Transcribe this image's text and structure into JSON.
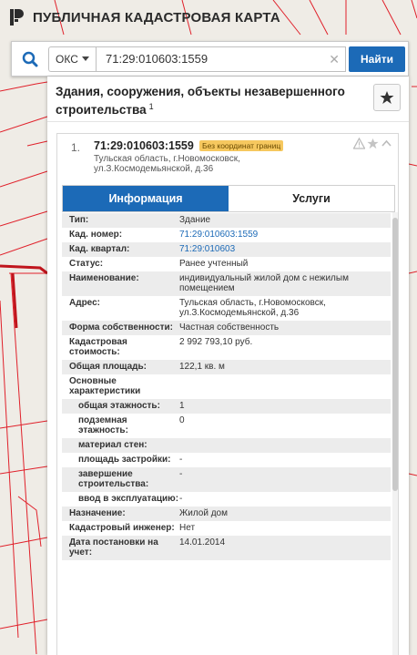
{
  "app": {
    "title": "ПУБЛИЧНАЯ КАДАСТРОВАЯ КАРТА"
  },
  "search": {
    "type_label": "ОКС",
    "query": "71:29:010603:1559",
    "button_label": "Найти"
  },
  "panel": {
    "title": "Здания, сооружения, объекты незавершенного строительства",
    "count": "1"
  },
  "item": {
    "number": "1.",
    "cad_number": "71:29:010603:1559",
    "badge": "Без координат границ",
    "address": "Тульская область, г.Новомосковск, ул.З.Космодемьянской, д.36"
  },
  "tabs": [
    {
      "label": "Информация"
    },
    {
      "label": "Услуги"
    }
  ],
  "info_rows": [
    {
      "key": "Тип:",
      "value": "Здание"
    },
    {
      "key": "Кад. номер:",
      "value": "71:29:010603:1559"
    },
    {
      "key": "Кад. квартал:",
      "value": "71:29:010603"
    },
    {
      "key": "Статус:",
      "value": "Ранее учтенный"
    },
    {
      "key": "Наименование:",
      "value": "индивидуальный жилой дом с нежилым помещением"
    },
    {
      "key": "Адрес:",
      "value": "Тульская область, г.Новомосковск, ул.З.Космодемьянской, д.36"
    },
    {
      "key": "Форма собственности:",
      "value": "Частная собственность"
    },
    {
      "key": "Кадастровая стоимость:",
      "value": "2 992 793,10 руб."
    },
    {
      "key": "Общая площадь:",
      "value": "122,1 кв. м"
    },
    {
      "key": "Основные характеристики",
      "value": ""
    },
    {
      "key": "общая этажность:",
      "value": "1"
    },
    {
      "key": "подземная этажность:",
      "value": "0"
    },
    {
      "key": "материал стен:",
      "value": ""
    },
    {
      "key": "площадь застройки:",
      "value": "-"
    },
    {
      "key": "завершение строительства:",
      "value": "-"
    },
    {
      "key": "ввод в эксплуатацию:",
      "value": "-"
    },
    {
      "key": "Назначение:",
      "value": "Жилой дом"
    },
    {
      "key": "Кадастровый инженер:",
      "value": "Нет"
    },
    {
      "key": "Дата постановки на учет:",
      "value": "14.01.2014"
    }
  ],
  "colors": {
    "accent": "#1c6ab7",
    "badge": "#f6c85f",
    "map_lines": "#e0202a"
  },
  "icons": {
    "search": "search-icon",
    "favorite": "star-icon",
    "warning": "warning-icon",
    "collapse": "chevron-up-icon",
    "clear": "close-icon"
  }
}
